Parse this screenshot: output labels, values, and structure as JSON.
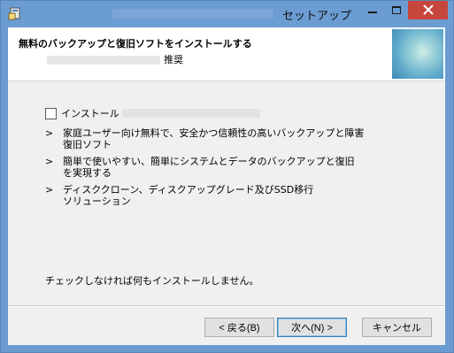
{
  "window": {
    "title": "セットアップ"
  },
  "header": {
    "title": "無料のバックアップと復旧ソフトをインストールする",
    "subtitle_suffix": "推奨"
  },
  "option": {
    "checkbox_label": "インストール",
    "checked": false
  },
  "bullets": [
    {
      "marker": ">",
      "text": "家庭ユーザー向け無料で、安全かつ信頼性の高いバックアップと障害\n復旧ソフト"
    },
    {
      "marker": ">",
      "text": "簡単で使いやすい、簡単にシステムとデータのバックアップと復旧\nを実現する"
    },
    {
      "marker": ">",
      "text": "ディスククローン、ディスクアップグレード及びSSD移行\nソリューション"
    }
  ],
  "footer_note": "チェックしなければ何もインストールしません。",
  "buttons": {
    "back": "< 戻る(B)",
    "next": "次へ(N) >",
    "cancel": "キャンセル"
  },
  "colors": {
    "titlebar": "#6b9dd3",
    "close_button": "#c7463c",
    "dialog_bg": "#f0f0f0"
  },
  "icons": [
    "setup-app-icon",
    "minimize-icon",
    "maximize-icon",
    "close-icon"
  ]
}
